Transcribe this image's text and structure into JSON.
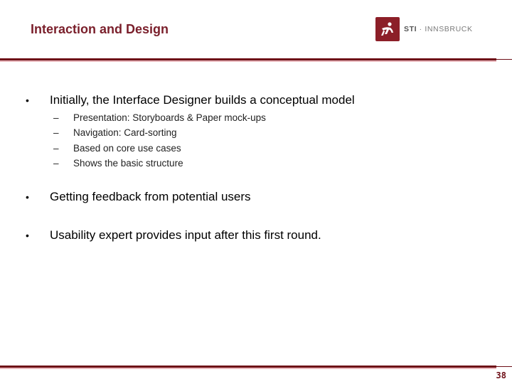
{
  "slide": {
    "title": "Interaction and Design",
    "page_number": "38",
    "accent_color": "#7a1f2b"
  },
  "logo": {
    "icon": "sti-runner-logo-icon",
    "brand": "STI",
    "separator": "·",
    "city": "INNSBRUCK"
  },
  "content": {
    "bullets": [
      {
        "text": "Initially, the Interface Designer builds a conceptual model",
        "marker": "•",
        "subitems": [
          {
            "marker": "–",
            "text": "Presentation: Storyboards & Paper mock-ups"
          },
          {
            "marker": "–",
            "text": "Navigation: Card-sorting"
          },
          {
            "marker": "–",
            "text": "Based on core use cases"
          },
          {
            "marker": "–",
            "text": "Shows the basic structure"
          }
        ]
      },
      {
        "text": "Getting feedback from potential users",
        "marker": "•"
      },
      {
        "text": "Usability expert provides input after this first round.",
        "marker": "•"
      }
    ]
  }
}
